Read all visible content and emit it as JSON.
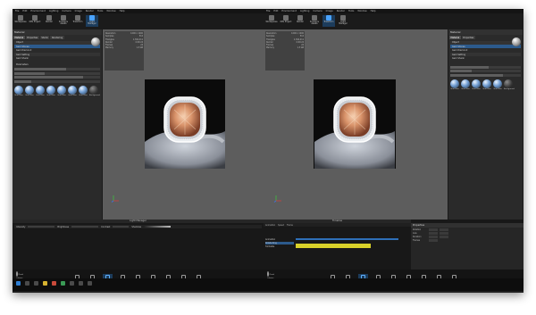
{
  "menu": [
    "File",
    "Edit",
    "Environment",
    "Lighting",
    "Camera",
    "Image",
    "Render",
    "Tools",
    "Window",
    "Help"
  ],
  "left": {
    "toolbar": [
      {
        "label": "Workspaces",
        "active": false
      },
      {
        "label": "KPG Project",
        "active": false
      },
      {
        "label": "Render",
        "active": false
      },
      {
        "label": "Scenes & Assets",
        "active": false
      },
      {
        "label": "Transform",
        "active": false
      },
      {
        "label": "Light Manager",
        "active": true
      }
    ],
    "panel": {
      "title": "Material",
      "tabs": [
        "Material",
        "Properties",
        "Studio",
        "Rendering"
      ],
      "rows": [
        "Object",
        "Gem Stones",
        "Gem Diamond",
        "Gem Setting",
        "Gem Shank"
      ],
      "selected_row": 1,
      "section_label": "Parameters",
      "swatches": [
        {
          "label": "Gem Blue",
          "dark": false
        },
        {
          "label": "Gem Blue",
          "dark": false
        },
        {
          "label": "Gem Blue",
          "dark": false
        },
        {
          "label": "Gem Blue",
          "dark": false
        },
        {
          "label": "Gem Blue",
          "dark": false
        },
        {
          "label": "Gem Blue",
          "dark": false
        },
        {
          "label": "Gem Blue",
          "dark": false
        },
        {
          "label": "Background",
          "dark": true
        }
      ]
    },
    "stats": [
      [
        "Resolution",
        "1000 x 1000"
      ],
      [
        "Samples",
        "512"
      ],
      [
        "Triangles",
        "1,304,211"
      ],
      [
        "Render",
        "0:00:24"
      ],
      [
        "Frames",
        "24"
      ],
      [
        "Memory",
        "1.5 GB"
      ]
    ],
    "bottom_title": "Light Manager",
    "light_row": [
      "Intensity",
      "Brightness",
      "Contrast",
      "Shadows"
    ]
  },
  "right": {
    "toolbar": [
      {
        "label": "Workspaces",
        "active": false
      },
      {
        "label": "KPG Project",
        "active": false
      },
      {
        "label": "Render",
        "active": false
      },
      {
        "label": "Scenes & Assets",
        "active": false
      },
      {
        "label": "Transform",
        "active": true
      },
      {
        "label": "Light Manager",
        "active": false
      }
    ],
    "panel": {
      "title": "Material",
      "tabs": [
        "Material",
        "Properties"
      ],
      "rows": [
        "Object",
        "Gem Stones",
        "Gem Diamond",
        "Gem Setting",
        "Gem Shank"
      ],
      "selected_row": 1,
      "swatches": [
        {
          "label": "Gem Blue",
          "dark": false
        },
        {
          "label": "Gem Blue",
          "dark": false
        },
        {
          "label": "Gem Blue",
          "dark": false
        },
        {
          "label": "Gem Blue",
          "dark": false
        },
        {
          "label": "Gem Blue",
          "dark": false
        },
        {
          "label": "Background",
          "dark": true
        }
      ]
    },
    "stats": [
      [
        "Resolution",
        "1000 x 1000"
      ],
      [
        "Samples",
        "512"
      ],
      [
        "Triangles",
        "1,304,211"
      ],
      [
        "Render",
        "0:00:24"
      ],
      [
        "Frames",
        "24"
      ],
      [
        "Memory",
        "1.5 GB"
      ]
    ],
    "timeline_title": "Timeline",
    "timeline_head": [
      "Animation",
      "Speed",
      "Frame"
    ],
    "timeline_rows": [
      "Animation",
      "Rotate Ring",
      "Turntable"
    ],
    "properties_title": "Properties",
    "properties_rows": [
      "Rotation",
      "Axis",
      "Duration",
      "Frames"
    ]
  },
  "dock": [
    {
      "label": "Import",
      "active": false
    },
    {
      "label": "Library",
      "active": false
    },
    {
      "label": "Project",
      "active": true
    },
    {
      "label": "Render",
      "active": false
    },
    {
      "label": "Animation",
      "active": false
    },
    {
      "label": "Web Viewer",
      "active": false
    },
    {
      "label": "KeyShotXR",
      "active": false
    },
    {
      "label": "Configurator",
      "active": false
    },
    {
      "label": "Script",
      "active": false
    }
  ],
  "dock_tip_left": "Cloud Library",
  "dock_tip_right": "Cloud Library",
  "colors": {
    "accent": "#4aa3ff",
    "selection": "#2c5a8c",
    "timeline_track": "#d9d22a"
  }
}
